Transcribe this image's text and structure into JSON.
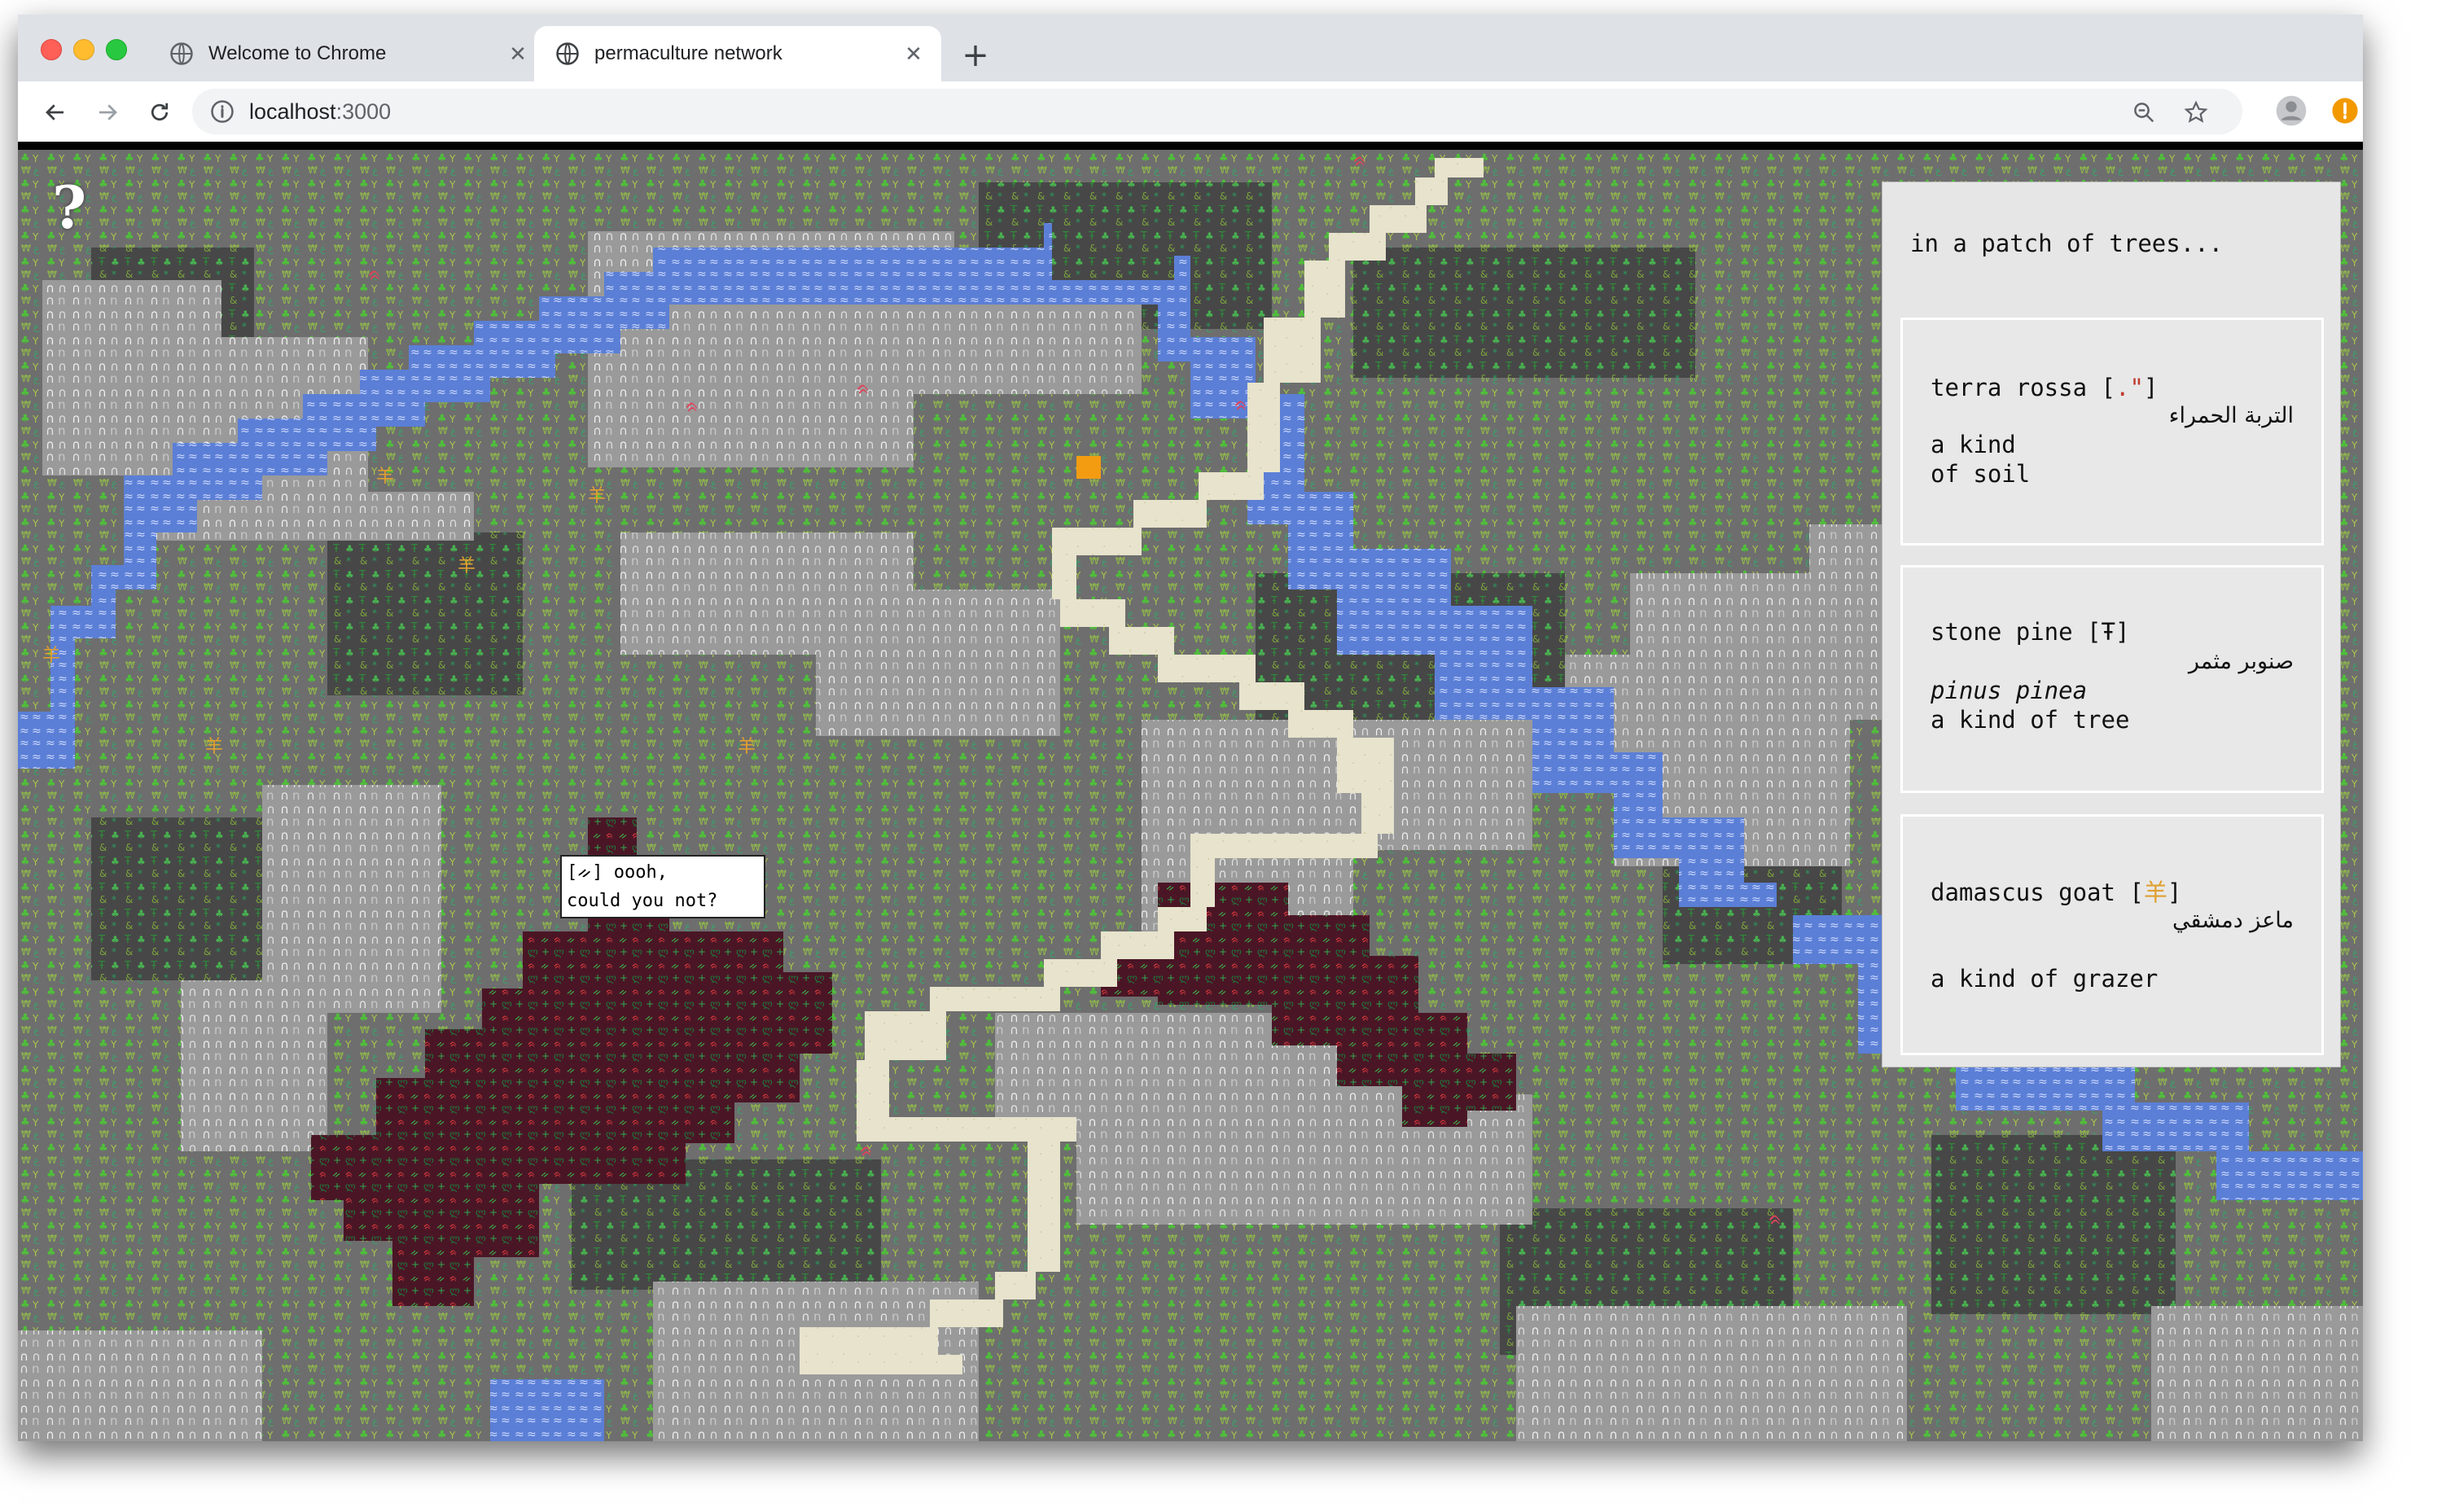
{
  "browser": {
    "tabs": [
      {
        "title": "Welcome to Chrome",
        "active": false
      },
      {
        "title": "permaculture network",
        "active": true
      }
    ],
    "address": {
      "host": "localhost",
      "port": ":3000"
    }
  },
  "map": {
    "help_label": "?",
    "speech_bubble": {
      "line1": "[ᨀ] oooh,",
      "line2": "could you not?"
    },
    "palette": {
      "background": "#6e6e6e",
      "river": "#5b7fd6",
      "path": "#e7e3cc",
      "red_soil": "#4a1626",
      "rock": "#9a9a9a",
      "dark_forest": "#474747"
    }
  },
  "panel": {
    "header": "in a patch of trees...",
    "cards": [
      {
        "name_prefix": "terra rossa [",
        "glyph": ".\"",
        "name_suffix": "]",
        "arabic": "التربة الحمراء",
        "latin": "",
        "kind_line1": "a kind",
        "kind_line2": "of soil",
        "glyph_color": "#c0392b"
      },
      {
        "name_prefix": "stone pine [",
        "glyph": "Ŧ",
        "name_suffix": "]",
        "arabic": "صنوبر مثمر",
        "latin": "pinus pinea",
        "kind_line1": "a kind of tree",
        "kind_line2": "",
        "glyph_color": "#333333"
      },
      {
        "name_prefix": "damascus goat [",
        "glyph": "羊",
        "name_suffix": "]",
        "arabic": "ماعز دمشقي",
        "latin": "",
        "kind_line1": "a kind of grazer",
        "kind_line2": "",
        "glyph_color": "#e0a030"
      }
    ]
  }
}
